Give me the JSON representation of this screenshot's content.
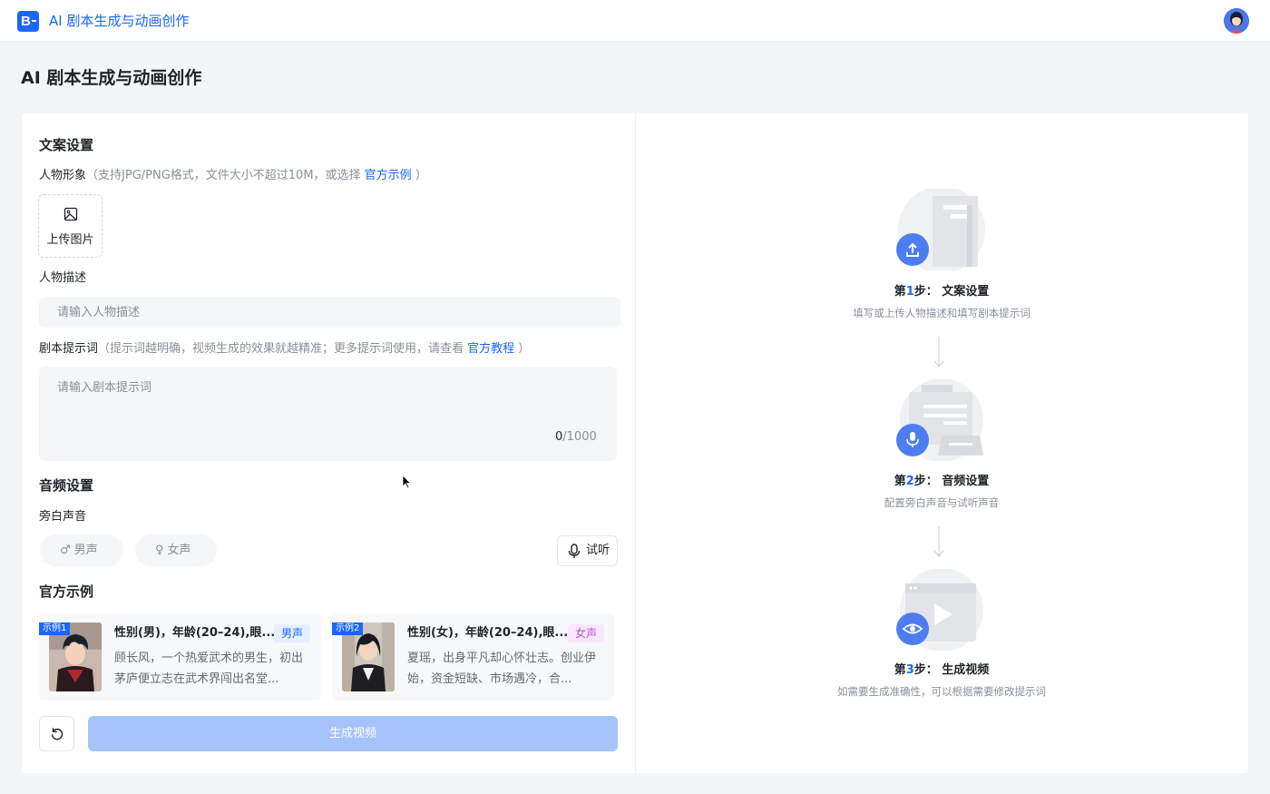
{
  "header": {
    "logo_text": "B",
    "app_title": "AI 剧本生成与动画创作"
  },
  "page": {
    "title": "AI 剧本生成与动画创作"
  },
  "copy_settings": {
    "section_title": "文案设置",
    "avatar_label": "人物形象",
    "avatar_hint": "（支持JPG/PNG格式，文件大小不超过10M，或选择 ",
    "avatar_link": "官方示例",
    "avatar_hint_end": " ）",
    "upload_label": "上传图片",
    "desc_label": "人物描述",
    "desc_placeholder": "请输入人物描述",
    "desc_value": "",
    "prompt_label": "剧本提示词",
    "prompt_hint": "（提示词越明确，视频生成的效果就越精准；更多提示词使用，请查看 ",
    "prompt_link": "官方教程",
    "prompt_hint_end": " ）",
    "prompt_placeholder": "请输入剧本提示词",
    "prompt_value": "",
    "counter_current": "0",
    "counter_max": "/1000"
  },
  "audio_settings": {
    "section_title": "音频设置",
    "narration_label": "旁白声音",
    "male_symbol": "♂",
    "male_label": "男声",
    "female_symbol": "♀",
    "female_label": "女声",
    "listen_label": "试听"
  },
  "examples": {
    "section_title": "官方示例",
    "items": [
      {
        "badge": "示例1",
        "title": "性别(男)，年龄(20–24),眼...",
        "tag": "男声",
        "desc": "顾长风，一个热爱武术的男生，初出茅庐便立志在武术界闯出名堂..."
      },
      {
        "badge": "示例2",
        "title": "性别(女)，年龄(20–24),眼...",
        "tag": "女声",
        "desc": "夏瑶，出身平凡却心怀壮志。创业伊始，资金短缺、市场遇冷，合..."
      }
    ]
  },
  "actions": {
    "generate_label": "生成视频"
  },
  "steps": [
    {
      "prefix": "第",
      "num": "1",
      "suffix": "步：  文案设置",
      "desc": "填写或上传人物描述和填写剧本提示词"
    },
    {
      "prefix": "第",
      "num": "2",
      "suffix": "步：  音频设置",
      "desc": "配置旁白声音与试听声音"
    },
    {
      "prefix": "第",
      "num": "3",
      "suffix": "步：  生成视频",
      "desc": "如需要生成准确性，可以根据需要修改提示词"
    }
  ],
  "colors": {
    "accent": "#1a66ff",
    "male_tag_bg": "#e6efff",
    "male_tag_fg": "#1a66ff",
    "female_tag_bg": "#f7e9fb",
    "female_tag_fg": "#c04fd6",
    "disabled_button": "#a6c4fb"
  }
}
